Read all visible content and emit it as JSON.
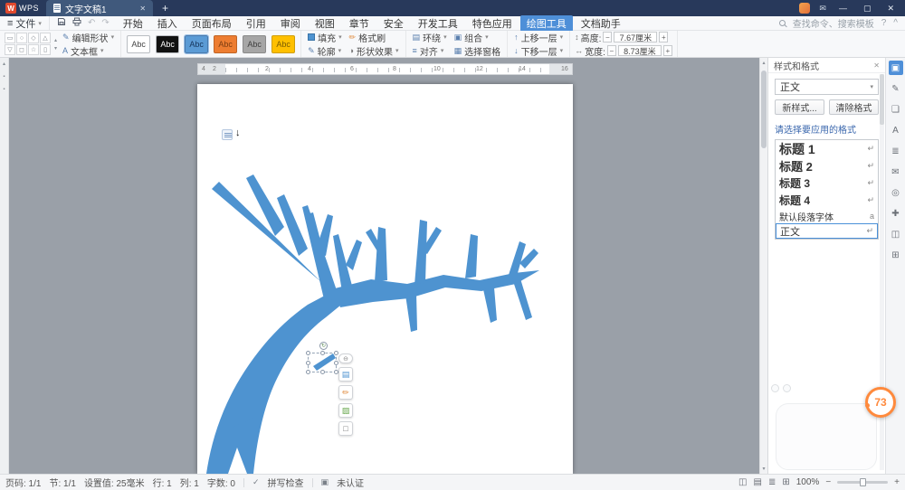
{
  "icons": {
    "close": "✕",
    "minimize": "—",
    "restore": "▢",
    "plus": "+",
    "caret": "▾",
    "caret_up": "▴",
    "hamburger": "≡",
    "undo": "↶",
    "redo": "↷",
    "message": "✉",
    "help": "?",
    "collapse": "^",
    "pencil": "✎",
    "brush": "✏",
    "effects": "◑",
    "wrap": "▤",
    "align": "≡",
    "group": "▣",
    "selection_pane": "▦",
    "up": "↑",
    "down": "↓",
    "height": "↕",
    "width": "↔",
    "rotate": "↻",
    "cursor": "↓",
    "text_box": "A",
    "shapes": [
      "▭",
      "○",
      "◇",
      "△",
      "▽",
      "◻",
      "☆",
      "▯"
    ],
    "quick": [
      "⊖",
      "▤",
      "✏",
      "▨",
      "□"
    ],
    "side": [
      "▣",
      "✎",
      "❏",
      "A",
      "≣",
      "✉",
      "◎",
      "✚",
      "◫",
      "⊞"
    ],
    "views": [
      "◫",
      "▤",
      "≣",
      "⊞"
    ]
  },
  "titlebar": {
    "logo_letter": "W",
    "logo_text": "WPS",
    "doc_tab": "文字文稿1"
  },
  "menubar": {
    "file": "文件",
    "menus": [
      "开始",
      "插入",
      "页面布局",
      "引用",
      "审阅",
      "视图",
      "章节",
      "安全",
      "开发工具",
      "特色应用",
      "绘图工具",
      "文档助手"
    ],
    "active": "绘图工具",
    "search": "查找命令、搜索模板"
  },
  "ribbon": {
    "edit_shape": "编辑形状",
    "text_box": "文本框",
    "chip_labels": [
      "Abc",
      "Abc",
      "Abc",
      "Abc",
      "Abc",
      "Abc"
    ],
    "chip_colors": [
      "#ffffff",
      "#111111",
      "#5b9bd5",
      "#ed7d31",
      "#a6a6a6",
      "#ffc000"
    ],
    "fill": "填充",
    "outline": "轮廓",
    "format_painter": "格式刷",
    "shape_effects": "形状效果",
    "wrap": "环绕",
    "align": "对齐",
    "group": "组合",
    "selection_pane": "选择窗格",
    "bring_forward": "上移一层",
    "send_backward": "下移一层",
    "height_label": "高度:",
    "height_value": "7.67厘米",
    "width_label": "宽度:",
    "width_value": "8.73厘米"
  },
  "ruler": {
    "margin_numbers": [
      "4",
      "2"
    ],
    "numbers": [
      "2",
      "4",
      "6",
      "8",
      "10",
      "12",
      "14",
      "16"
    ]
  },
  "canvas": {
    "shape_fill": "#4e93d0"
  },
  "styles_panel": {
    "title": "样式和格式",
    "current": "正文",
    "new_style": "新样式...",
    "clear": "清除格式",
    "hint": "请选择要应用的格式",
    "items": [
      {
        "label": "标题 1",
        "mark": "↵"
      },
      {
        "label": "标题 2",
        "mark": "↵"
      },
      {
        "label": "标题 3",
        "mark": "↵"
      },
      {
        "label": "标题 4",
        "mark": "↵"
      },
      {
        "label": "默认段落字体",
        "mark": "a"
      },
      {
        "label": "正文",
        "mark": "↵"
      }
    ]
  },
  "status": {
    "items": [
      "页码: 1/1",
      "节: 1/1",
      "设置值: 25毫米",
      "行: 1",
      "列: 1",
      "字数: 0"
    ],
    "spell": "拼写检查",
    "cert": "未认证",
    "zoom": "100%",
    "zoom_minus": "−",
    "zoom_plus": "+"
  },
  "badge": {
    "value": "73"
  }
}
